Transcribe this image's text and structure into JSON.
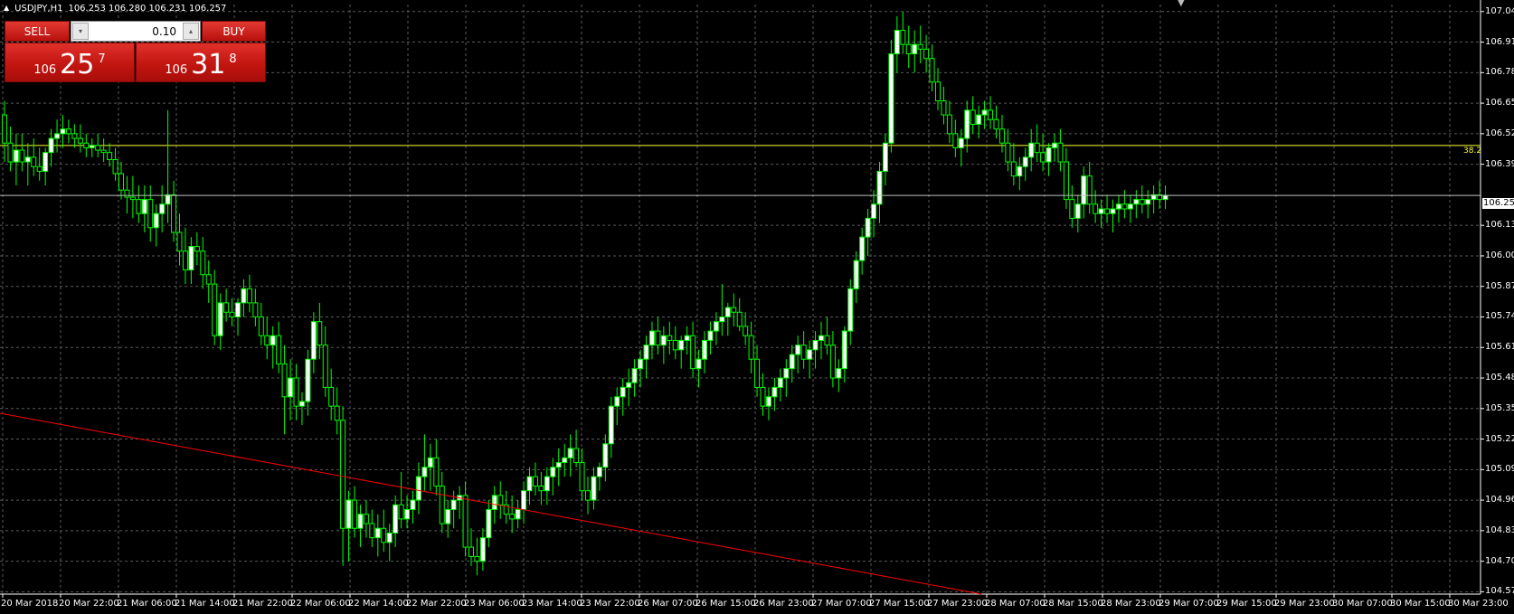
{
  "header": {
    "symbol": "USDJPY,H1",
    "ohlc": "106.253 106.280 106.231 106.257"
  },
  "trade_panel": {
    "sell_label": "SELL",
    "buy_label": "BUY",
    "lot_value": "0.10",
    "sell_price": {
      "prefix": "106",
      "main": "25",
      "sup": "7"
    },
    "buy_price": {
      "prefix": "106",
      "main": "31",
      "sup": "8"
    }
  },
  "colors": {
    "background": "#000000",
    "grid": "#5a5a5a",
    "bull_candle": "#ffffff",
    "bear_candle": "#000000",
    "candle_outline": "#00ff00",
    "fib_line": "#ffff33",
    "trendline": "#ff0000",
    "panel_red": "#c0140f"
  },
  "price_axis": [
    "107.040",
    "106.910",
    "106.780",
    "106.650",
    "106.520",
    "106.390",
    "106.130",
    "106.000",
    "105.870",
    "105.740",
    "105.610",
    "105.480",
    "105.350",
    "105.220",
    "105.090",
    "104.960",
    "104.830",
    "104.700",
    "104.570"
  ],
  "current_price_tag": "106.257",
  "fib_label": "38.2",
  "time_axis": [
    "20 Mar 2018",
    "20 Mar 22:00",
    "21 Mar 06:00",
    "21 Mar 14:00",
    "21 Mar 22:00",
    "22 Mar 06:00",
    "22 Mar 14:00",
    "22 Mar 22:00",
    "23 Mar 06:00",
    "23 Mar 14:00",
    "23 Mar 22:00",
    "26 Mar 07:00",
    "26 Mar 15:00",
    "26 Mar 23:00",
    "27 Mar 07:00",
    "27 Mar 15:00",
    "27 Mar 23:00",
    "28 Mar 07:00",
    "28 Mar 15:00",
    "28 Mar 23:00",
    "29 Mar 07:00",
    "29 Mar 15:00",
    "29 Mar 23:00",
    "30 Mar 07:00",
    "30 Mar 15:00",
    "30 Mar 23:00"
  ],
  "chart_data": {
    "type": "candlestick",
    "symbol": "USDJPY",
    "timeframe": "H1",
    "ylim": [
      104.56,
      107.07
    ],
    "fib_level": {
      "label": "38.2",
      "price": 106.47
    },
    "current_price": 106.257,
    "trendline": {
      "from": {
        "bar": 0,
        "price": 105.33
      },
      "to": {
        "bar": 253,
        "price": 104.56
      }
    },
    "candles": [
      [
        106.6,
        106.66,
        106.4,
        106.48
      ],
      [
        106.48,
        106.55,
        106.36,
        106.4
      ],
      [
        106.4,
        106.52,
        106.3,
        106.45
      ],
      [
        106.45,
        106.52,
        106.36,
        106.4
      ],
      [
        106.4,
        106.48,
        106.3,
        106.42
      ],
      [
        106.42,
        106.5,
        106.34,
        106.38
      ],
      [
        106.38,
        106.46,
        106.32,
        106.36
      ],
      [
        106.36,
        106.46,
        106.3,
        106.44
      ],
      [
        106.44,
        106.54,
        106.38,
        106.5
      ],
      [
        106.5,
        106.58,
        106.44,
        106.52
      ],
      [
        106.52,
        106.6,
        106.46,
        106.54
      ],
      [
        106.54,
        106.58,
        106.48,
        106.52
      ],
      [
        106.52,
        106.56,
        106.46,
        106.5
      ],
      [
        106.5,
        106.56,
        106.44,
        106.48
      ],
      [
        106.48,
        106.52,
        106.42,
        106.46
      ],
      [
        106.46,
        106.5,
        106.42,
        106.47
      ],
      [
        106.47,
        106.52,
        106.42,
        106.45
      ],
      [
        106.45,
        106.5,
        106.4,
        106.44
      ],
      [
        106.44,
        106.48,
        106.38,
        106.41
      ],
      [
        106.41,
        106.46,
        106.32,
        106.35
      ],
      [
        106.35,
        106.4,
        106.24,
        106.28
      ],
      [
        106.28,
        106.34,
        106.18,
        106.25
      ],
      [
        106.25,
        106.34,
        106.16,
        106.24
      ],
      [
        106.24,
        106.3,
        106.14,
        106.18
      ],
      [
        106.18,
        106.3,
        106.1,
        106.24
      ],
      [
        106.24,
        106.3,
        106.06,
        106.12
      ],
      [
        106.12,
        106.22,
        106.04,
        106.18
      ],
      [
        106.18,
        106.3,
        106.1,
        106.22
      ],
      [
        106.22,
        106.62,
        106.14,
        106.26
      ],
      [
        106.26,
        106.32,
        106.06,
        106.1
      ],
      [
        106.1,
        106.18,
        105.96,
        106.02
      ],
      [
        106.02,
        106.12,
        105.88,
        105.94
      ],
      [
        105.94,
        106.08,
        105.88,
        106.04
      ],
      [
        106.04,
        106.1,
        105.96,
        106.02
      ],
      [
        106.02,
        106.08,
        105.86,
        105.92
      ],
      [
        105.92,
        105.98,
        105.8,
        105.88
      ],
      [
        105.88,
        105.94,
        105.62,
        105.66
      ],
      [
        105.66,
        105.84,
        105.6,
        105.8
      ],
      [
        105.8,
        105.86,
        105.72,
        105.76
      ],
      [
        105.76,
        105.82,
        105.7,
        105.74
      ],
      [
        105.74,
        105.82,
        105.66,
        105.8
      ],
      [
        105.8,
        105.9,
        105.74,
        105.86
      ],
      [
        105.86,
        105.92,
        105.76,
        105.8
      ],
      [
        105.8,
        105.86,
        105.7,
        105.74
      ],
      [
        105.74,
        105.8,
        105.62,
        105.66
      ],
      [
        105.66,
        105.74,
        105.56,
        105.62
      ],
      [
        105.62,
        105.7,
        105.52,
        105.66
      ],
      [
        105.66,
        105.72,
        105.5,
        105.54
      ],
      [
        105.54,
        105.62,
        105.24,
        105.4
      ],
      [
        105.4,
        105.56,
        105.3,
        105.48
      ],
      [
        105.48,
        105.54,
        105.3,
        105.36
      ],
      [
        105.36,
        105.42,
        105.28,
        105.38
      ],
      [
        105.38,
        105.6,
        105.32,
        105.56
      ],
      [
        105.56,
        105.76,
        105.5,
        105.72
      ],
      [
        105.72,
        105.8,
        105.56,
        105.62
      ],
      [
        105.62,
        105.7,
        105.4,
        105.44
      ],
      [
        105.44,
        105.52,
        105.3,
        105.36
      ],
      [
        105.36,
        105.44,
        105.24,
        105.3
      ],
      [
        105.3,
        105.36,
        104.68,
        104.84
      ],
      [
        104.84,
        105.0,
        104.7,
        104.96
      ],
      [
        104.96,
        105.02,
        104.8,
        104.84
      ],
      [
        104.84,
        104.94,
        104.76,
        104.9
      ],
      [
        104.9,
        104.96,
        104.8,
        104.86
      ],
      [
        104.86,
        104.92,
        104.76,
        104.8
      ],
      [
        104.8,
        104.9,
        104.72,
        104.84
      ],
      [
        104.84,
        104.92,
        104.74,
        104.78
      ],
      [
        104.78,
        104.86,
        104.7,
        104.82
      ],
      [
        104.82,
        104.98,
        104.76,
        104.94
      ],
      [
        104.94,
        105.08,
        104.84,
        104.88
      ],
      [
        104.88,
        104.98,
        104.84,
        104.92
      ],
      [
        104.92,
        105.0,
        104.86,
        104.96
      ],
      [
        104.96,
        105.12,
        104.9,
        105.06
      ],
      [
        105.06,
        105.24,
        105.0,
        105.1
      ],
      [
        105.1,
        105.2,
        105.0,
        105.14
      ],
      [
        105.14,
        105.22,
        104.98,
        105.02
      ],
      [
        105.02,
        105.08,
        104.82,
        104.86
      ],
      [
        104.86,
        104.96,
        104.8,
        104.92
      ],
      [
        104.92,
        105.0,
        104.84,
        104.96
      ],
      [
        104.96,
        105.02,
        104.88,
        104.98
      ],
      [
        104.98,
        105.04,
        104.72,
        104.76
      ],
      [
        104.76,
        104.84,
        104.68,
        104.72
      ],
      [
        104.72,
        104.8,
        104.64,
        104.7
      ],
      [
        104.7,
        104.84,
        104.66,
        104.8
      ],
      [
        104.8,
        104.96,
        104.76,
        104.92
      ],
      [
        104.92,
        105.02,
        104.86,
        104.98
      ],
      [
        104.98,
        105.04,
        104.88,
        104.94
      ],
      [
        104.94,
        105.0,
        104.86,
        104.9
      ],
      [
        104.9,
        104.98,
        104.82,
        104.88
      ],
      [
        104.88,
        104.96,
        104.84,
        104.92
      ],
      [
        104.92,
        105.04,
        104.86,
        105.0
      ],
      [
        105.0,
        105.1,
        104.94,
        105.06
      ],
      [
        105.06,
        105.12,
        104.98,
        105.02
      ],
      [
        105.02,
        105.08,
        104.94,
        105.0
      ],
      [
        105.0,
        105.1,
        104.94,
        105.06
      ],
      [
        105.06,
        105.14,
        104.98,
        105.1
      ],
      [
        105.1,
        105.18,
        105.02,
        105.12
      ],
      [
        105.12,
        105.2,
        105.06,
        105.14
      ],
      [
        105.14,
        105.24,
        105.06,
        105.18
      ],
      [
        105.18,
        105.26,
        105.1,
        105.12
      ],
      [
        105.12,
        105.18,
        104.96,
        105.0
      ],
      [
        105.0,
        105.06,
        104.9,
        104.96
      ],
      [
        104.96,
        105.1,
        104.92,
        105.06
      ],
      [
        105.06,
        105.12,
        105.0,
        105.1
      ],
      [
        105.1,
        105.24,
        105.04,
        105.2
      ],
      [
        105.2,
        105.4,
        105.14,
        105.36
      ],
      [
        105.36,
        105.44,
        105.28,
        105.4
      ],
      [
        105.4,
        105.48,
        105.32,
        105.44
      ],
      [
        105.44,
        105.52,
        105.36,
        105.46
      ],
      [
        105.46,
        105.56,
        105.4,
        105.52
      ],
      [
        105.52,
        105.6,
        105.44,
        105.56
      ],
      [
        105.56,
        105.66,
        105.48,
        105.62
      ],
      [
        105.62,
        105.72,
        105.56,
        105.68
      ],
      [
        105.68,
        105.74,
        105.58,
        105.62
      ],
      [
        105.62,
        105.7,
        105.54,
        105.66
      ],
      [
        105.66,
        105.72,
        105.58,
        105.64
      ],
      [
        105.64,
        105.7,
        105.56,
        105.6
      ],
      [
        105.6,
        105.66,
        105.52,
        105.64
      ],
      [
        105.64,
        105.7,
        105.58,
        105.66
      ],
      [
        105.66,
        105.72,
        105.48,
        105.52
      ],
      [
        105.52,
        105.6,
        105.44,
        105.56
      ],
      [
        105.56,
        105.68,
        105.5,
        105.64
      ],
      [
        105.64,
        105.72,
        105.58,
        105.68
      ],
      [
        105.68,
        105.76,
        105.62,
        105.72
      ],
      [
        105.72,
        105.88,
        105.66,
        105.74
      ],
      [
        105.74,
        105.8,
        105.66,
        105.78
      ],
      [
        105.78,
        105.84,
        105.7,
        105.76
      ],
      [
        105.76,
        105.82,
        105.68,
        105.7
      ],
      [
        105.7,
        105.76,
        105.62,
        105.66
      ],
      [
        105.66,
        105.72,
        105.5,
        105.56
      ],
      [
        105.56,
        105.62,
        105.4,
        105.44
      ],
      [
        105.44,
        105.5,
        105.32,
        105.36
      ],
      [
        105.36,
        105.44,
        105.3,
        105.4
      ],
      [
        105.4,
        105.48,
        105.34,
        105.44
      ],
      [
        105.44,
        105.52,
        105.38,
        105.48
      ],
      [
        105.48,
        105.56,
        105.4,
        105.52
      ],
      [
        105.52,
        105.62,
        105.46,
        105.58
      ],
      [
        105.58,
        105.66,
        105.5,
        105.62
      ],
      [
        105.62,
        105.68,
        105.52,
        105.56
      ],
      [
        105.56,
        105.64,
        105.48,
        105.6
      ],
      [
        105.6,
        105.68,
        105.52,
        105.64
      ],
      [
        105.64,
        105.72,
        105.56,
        105.66
      ],
      [
        105.66,
        105.74,
        105.58,
        105.62
      ],
      [
        105.62,
        105.68,
        105.44,
        105.48
      ],
      [
        105.48,
        105.56,
        105.42,
        105.52
      ],
      [
        105.52,
        105.7,
        105.46,
        105.68
      ],
      [
        105.68,
        105.9,
        105.62,
        105.86
      ],
      [
        105.86,
        106.02,
        105.8,
        105.98
      ],
      [
        105.98,
        106.12,
        105.92,
        106.08
      ],
      [
        106.08,
        106.2,
        106.0,
        106.16
      ],
      [
        106.16,
        106.28,
        106.08,
        106.22
      ],
      [
        106.22,
        106.4,
        106.14,
        106.36
      ],
      [
        106.36,
        106.52,
        106.3,
        106.48
      ],
      [
        106.48,
        106.92,
        106.44,
        106.86
      ],
      [
        106.86,
        107.02,
        106.78,
        106.96
      ],
      [
        106.96,
        107.04,
        106.86,
        106.9
      ],
      [
        106.9,
        106.98,
        106.8,
        106.86
      ],
      [
        106.86,
        106.96,
        106.78,
        106.9
      ],
      [
        106.9,
        106.98,
        106.82,
        106.88
      ],
      [
        106.88,
        106.94,
        106.78,
        106.84
      ],
      [
        106.84,
        106.9,
        106.7,
        106.74
      ],
      [
        106.74,
        106.8,
        106.62,
        106.66
      ],
      [
        106.66,
        106.72,
        106.56,
        106.6
      ],
      [
        106.6,
        106.66,
        106.48,
        106.52
      ],
      [
        106.52,
        106.58,
        106.42,
        106.46
      ],
      [
        106.46,
        106.54,
        106.38,
        106.5
      ],
      [
        106.5,
        106.66,
        106.44,
        106.62
      ],
      [
        106.62,
        106.68,
        106.52,
        106.56
      ],
      [
        106.56,
        106.64,
        106.5,
        106.6
      ],
      [
        106.6,
        106.66,
        106.54,
        106.62
      ],
      [
        106.62,
        106.68,
        106.54,
        106.58
      ],
      [
        106.58,
        106.64,
        106.5,
        106.54
      ],
      [
        106.54,
        106.6,
        106.44,
        106.48
      ],
      [
        106.48,
        106.54,
        106.36,
        106.4
      ],
      [
        106.4,
        106.48,
        106.3,
        106.34
      ],
      [
        106.34,
        106.42,
        106.28,
        106.38
      ],
      [
        106.38,
        106.46,
        106.32,
        106.42
      ],
      [
        106.42,
        106.54,
        106.36,
        106.48
      ],
      [
        106.48,
        106.56,
        106.4,
        106.44
      ],
      [
        106.44,
        106.52,
        106.36,
        106.4
      ],
      [
        106.4,
        106.48,
        106.34,
        106.46
      ],
      [
        106.46,
        106.52,
        106.4,
        106.48
      ],
      [
        106.48,
        106.54,
        106.36,
        106.4
      ],
      [
        106.4,
        106.46,
        106.2,
        106.24
      ],
      [
        106.24,
        106.3,
        106.12,
        106.16
      ],
      [
        106.16,
        106.26,
        106.1,
        106.22
      ],
      [
        106.22,
        106.38,
        106.16,
        106.34
      ],
      [
        106.34,
        106.4,
        106.18,
        106.22
      ],
      [
        106.22,
        106.28,
        106.14,
        106.18
      ],
      [
        106.18,
        106.24,
        106.12,
        106.2
      ],
      [
        106.2,
        106.26,
        106.14,
        106.18
      ],
      [
        106.18,
        106.24,
        106.1,
        106.2
      ],
      [
        106.2,
        106.26,
        106.14,
        106.22
      ],
      [
        106.22,
        106.28,
        106.16,
        106.2
      ],
      [
        106.2,
        106.26,
        106.14,
        106.22
      ],
      [
        106.22,
        106.28,
        106.16,
        106.24
      ],
      [
        106.24,
        106.3,
        106.18,
        106.22
      ],
      [
        106.22,
        106.28,
        106.16,
        106.24
      ],
      [
        106.24,
        106.3,
        106.18,
        106.26
      ],
      [
        106.26,
        106.32,
        106.2,
        106.24
      ],
      [
        106.24,
        106.3,
        106.2,
        106.257
      ]
    ]
  }
}
